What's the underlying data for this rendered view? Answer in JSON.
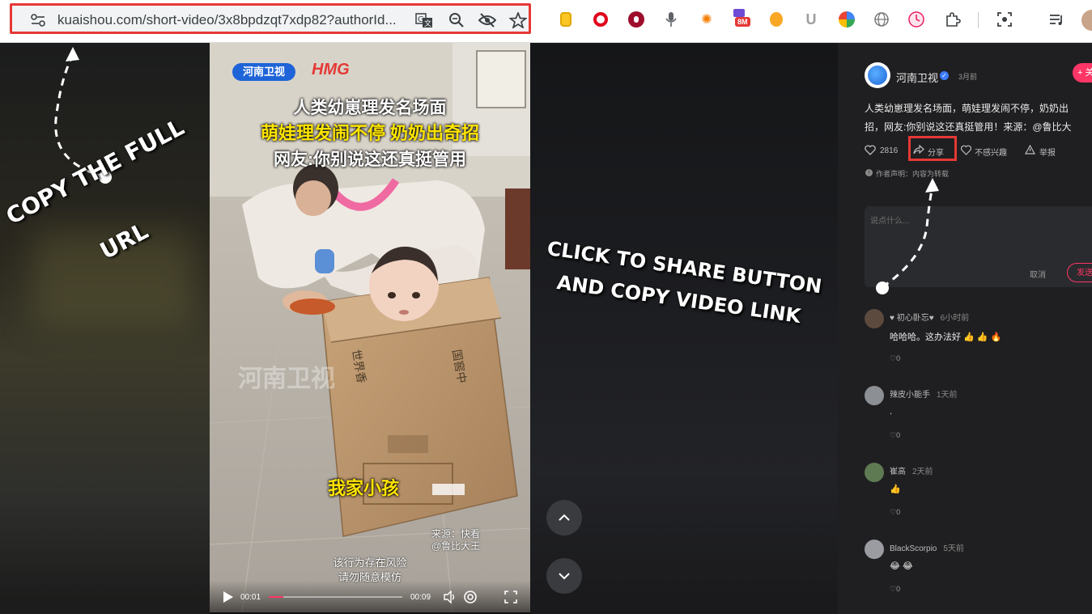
{
  "browser": {
    "url": "kuaishou.com/short-video/3x8bpdzqt7xdp82?authorId...",
    "ext_badge": "8M"
  },
  "annotations": {
    "copy_url": "COPY THE FULL",
    "copy_url_line2": "URL",
    "share_line1": "CLICK TO SHARE BUTTON",
    "share_line2": "AND COPY VIDEO LINK"
  },
  "video": {
    "logo_channel": "河南卫视",
    "logo_hmg": "HMG",
    "title_line1": "人类幼崽理发名场面",
    "title_line2": "萌娃理发闹不停 奶奶出奇招",
    "title_line3": "网友:你别说这还真挺管用",
    "caption": "我家小孩",
    "source_line1": "来源：快看",
    "source_line2": "@鲁比大王",
    "warning_line1": "该行为存在风险",
    "warning_line2": "请勿随意模仿",
    "watermark": "河南卫视",
    "box_text1": "世界香",
    "box_text2": "国窖中",
    "current_time": "00:01",
    "duration": "00:09",
    "progress": 0.11
  },
  "author": {
    "name": "河南卫视",
    "time": "3月前",
    "follow_label": "+ 关注"
  },
  "description": {
    "line1": "人类幼崽理发名场面，萌娃理发闹不停，奶奶出",
    "line2": "招，网友:你别说这还真挺管用！来源：@鲁比大"
  },
  "actions": {
    "likes": "2816",
    "share": "分享",
    "not_interested": "不感兴趣",
    "report": "举报"
  },
  "statement": "作者声明：内容为转载",
  "comment_box": {
    "placeholder": "说点什么...",
    "cancel": "取消",
    "send": "发送"
  },
  "comments": [
    {
      "name": "♥ 初心卧忘♥",
      "time": "6小时前",
      "text": "哈哈哈。这办法好 👍 👍 🔥",
      "likes": "0"
    },
    {
      "name": "辣皮小能手",
      "time": "1天前",
      "text": ".",
      "likes": "0"
    },
    {
      "name": "崔高",
      "time": "2天前",
      "text": "👍",
      "likes": "0"
    },
    {
      "name": "BlackScorpio",
      "time": "5天前",
      "text": "😂 😂",
      "likes": "0"
    }
  ],
  "colors": {
    "highlight": "#e53935",
    "follow": "#fe3666",
    "panel": "#1f1f21"
  }
}
